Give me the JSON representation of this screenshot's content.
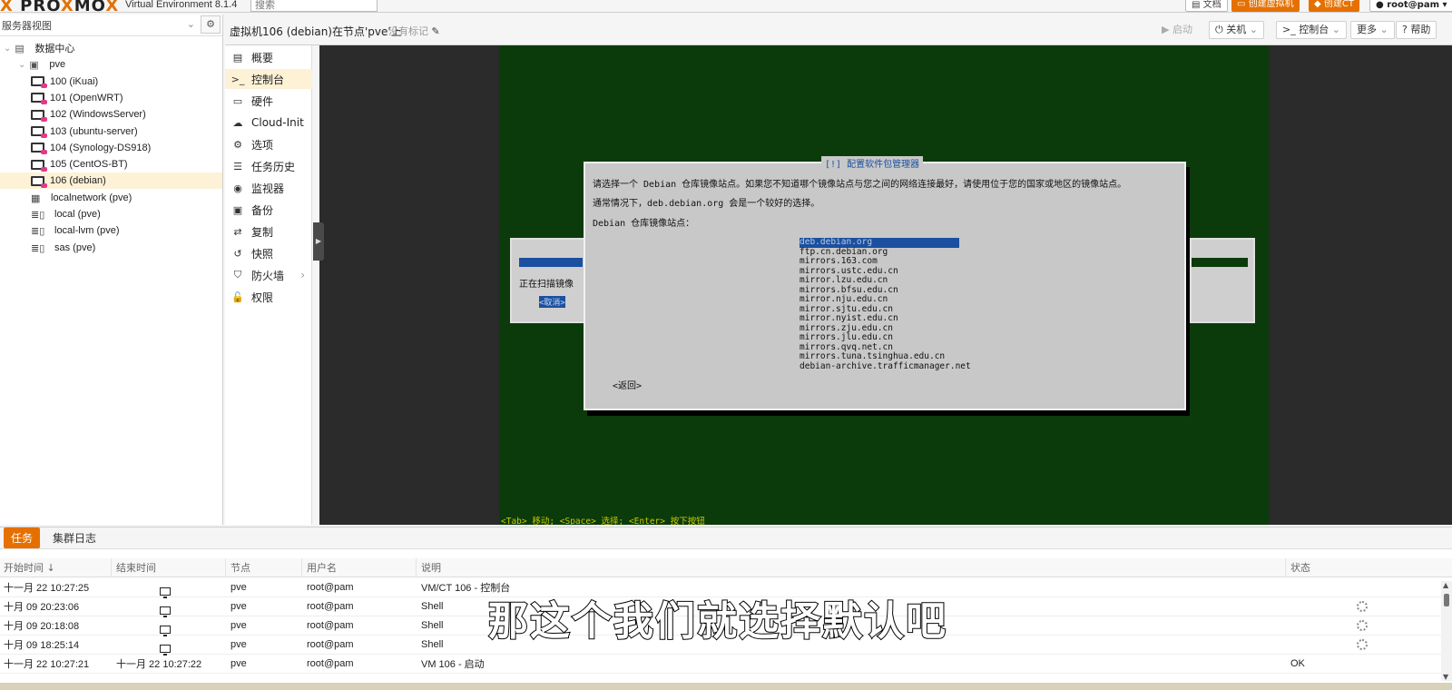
{
  "topbar": {
    "logo": "PROXMOX",
    "version": "Virtual Environment 8.1.4",
    "search_placeholder": "搜索",
    "doc_label": "文档",
    "create_vm_label": "创建虚拟机",
    "create_ct_label": "创建CT",
    "user_label": "root@pam"
  },
  "sidebar": {
    "view_label": "服务器视图",
    "items": [
      {
        "label": "数据中心",
        "icon": "datacenter-icon"
      },
      {
        "label": "pve",
        "icon": "node-icon"
      },
      {
        "label": "100 (iKuai)",
        "icon": "vm-icon"
      },
      {
        "label": "101 (OpenWRT)",
        "icon": "vm-icon"
      },
      {
        "label": "102 (WindowsServer)",
        "icon": "vm-icon"
      },
      {
        "label": "103 (ubuntu-server)",
        "icon": "vm-icon"
      },
      {
        "label": "104 (Synology-DS918)",
        "icon": "vm-icon"
      },
      {
        "label": "105 (CentOS-BT)",
        "icon": "vm-icon"
      },
      {
        "label": "106 (debian)",
        "icon": "vm-icon"
      },
      {
        "label": "localnetwork (pve)",
        "icon": "network-icon"
      },
      {
        "label": "local (pve)",
        "icon": "storage-icon"
      },
      {
        "label": "local-lvm (pve)",
        "icon": "storage-icon"
      },
      {
        "label": "sas (pve)",
        "icon": "storage-icon"
      }
    ]
  },
  "vmheader": {
    "title": "虚拟机106 (debian)在节点'pve'上",
    "tags": "没有标记",
    "start_label": "启动",
    "shutdown_label": "关机",
    "console_label": "控制台",
    "more_label": "更多",
    "help_label": "帮助"
  },
  "nav": {
    "items": [
      {
        "label": "概要",
        "icon": "book-icon"
      },
      {
        "label": "控制台",
        "icon": "terminal-icon"
      },
      {
        "label": "硬件",
        "icon": "monitor-icon"
      },
      {
        "label": "Cloud-Init",
        "icon": "cloud-icon"
      },
      {
        "label": "选项",
        "icon": "gear-icon"
      },
      {
        "label": "任务历史",
        "icon": "list-icon"
      },
      {
        "label": "监视器",
        "icon": "eye-icon"
      },
      {
        "label": "备份",
        "icon": "floppy-icon"
      },
      {
        "label": "复制",
        "icon": "retweet-icon"
      },
      {
        "label": "快照",
        "icon": "history-icon"
      },
      {
        "label": "防火墙",
        "icon": "shield-icon"
      },
      {
        "label": "权限",
        "icon": "unlock-icon"
      }
    ]
  },
  "terminal": {
    "bg_scanning": "正在扫描镜像",
    "bg_cancel": "<取消>",
    "dialog_title": "[!] 配置软件包管理器",
    "line1": "请选择一个 Debian 仓库镜像站点。如果您不知道哪个镜像站点与您之间的网络连接最好，请使用位于您的国家或地区的镜像站点。",
    "line2": "通常情况下，deb.debian.org 会是一个较好的选择。",
    "line3": "Debian 仓库镜像站点：",
    "mirrors": [
      "deb.debian.org",
      "ftp.cn.debian.org",
      "mirrors.163.com",
      "mirrors.ustc.edu.cn",
      "mirror.lzu.edu.cn",
      "mirrors.bfsu.edu.cn",
      "mirror.nju.edu.cn",
      "mirror.sjtu.edu.cn",
      "mirror.nyist.edu.cn",
      "mirrors.zju.edu.cn",
      "mirrors.jlu.edu.cn",
      "mirrors.qvq.net.cn",
      "mirrors.tuna.tsinghua.edu.cn",
      "debian-archive.trafficmanager.net"
    ],
    "back_label": "<返回>",
    "hint": "<Tab> 移动; <Space> 选择; <Enter> 按下按钮"
  },
  "bottom": {
    "tabs": [
      "任务",
      "集群日志"
    ],
    "columns": [
      "开始时间 ↓",
      "结束时间",
      "节点",
      "用户名",
      "说明",
      "状态"
    ],
    "rows": [
      {
        "start": "十一月 22 10:27:25",
        "end": "",
        "node": "pve",
        "user": "root@pam",
        "desc": "VM/CT 106 - 控制台",
        "status": "",
        "icon": "monitor"
      },
      {
        "start": "十月 09 20:23:06",
        "end": "",
        "node": "pve",
        "user": "root@pam",
        "desc": "Shell",
        "status": "",
        "icon": "monitor",
        "spinner": true
      },
      {
        "start": "十月 09 20:18:08",
        "end": "",
        "node": "pve",
        "user": "root@pam",
        "desc": "Shell",
        "status": "",
        "icon": "monitor",
        "spinner": true
      },
      {
        "start": "十月 09 18:25:14",
        "end": "",
        "node": "pve",
        "user": "root@pam",
        "desc": "Shell",
        "status": "",
        "icon": "monitor",
        "spinner": true
      },
      {
        "start": "十一月 22 10:27:21",
        "end": "十一月 22 10:27:22",
        "node": "pve",
        "user": "root@pam",
        "desc": "VM 106 - 启动",
        "status": "OK",
        "icon": ""
      }
    ]
  },
  "subtitle": "那这个我们就选择默认吧",
  "colors": {
    "accent": "#e57000",
    "selected_bg": "#fdf1d6",
    "terminal_bg": "#0b3b0b"
  }
}
